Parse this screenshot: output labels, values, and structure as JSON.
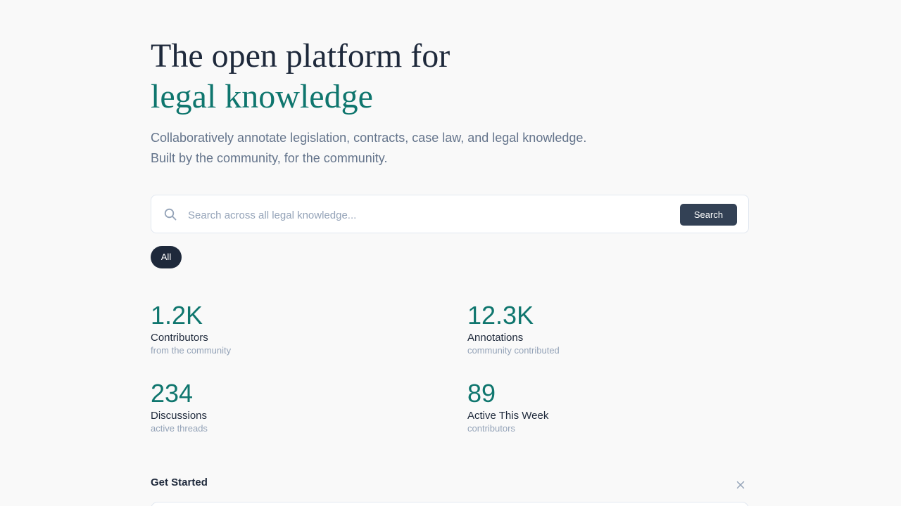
{
  "hero": {
    "title_line1": "The open platform for",
    "title_line2": "legal knowledge",
    "subtitle_line1": "Collaboratively annotate legislation, contracts, case law, and legal knowledge.",
    "subtitle_line2": "Built by the community, for the community."
  },
  "search": {
    "placeholder": "Search across all legal knowledge...",
    "value": "",
    "button_label": "Search",
    "icon": "search-icon"
  },
  "filters": {
    "selected": "All",
    "items": [
      {
        "label": "All",
        "active": true
      }
    ]
  },
  "stats": [
    {
      "value": "1.2K",
      "label": "Contributors",
      "sub": "from the community"
    },
    {
      "value": "12.3K",
      "label": "Annotations",
      "sub": "community contributed"
    },
    {
      "value": "234",
      "label": "Discussions",
      "sub": "active threads"
    },
    {
      "value": "89",
      "label": "Active This Week",
      "sub": "contributors"
    }
  ],
  "get_started": {
    "title": "Get Started",
    "close_icon": "close-icon"
  },
  "colors": {
    "background": "#f9f9f9",
    "accent": "#0f766e",
    "heading": "#1e293b",
    "muted": "#64748b",
    "button": "#334155"
  }
}
